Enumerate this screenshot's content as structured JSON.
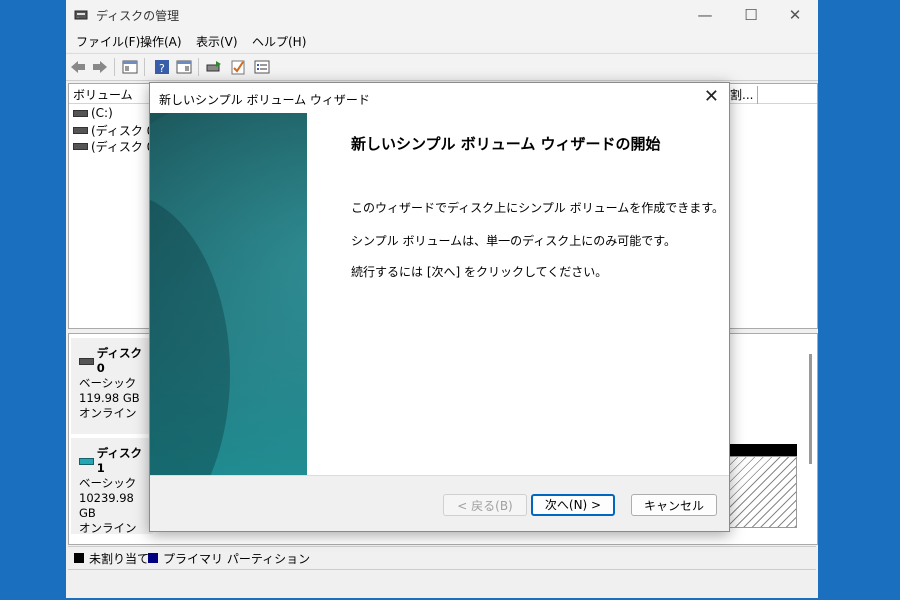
{
  "window": {
    "title": "ディスクの管理",
    "controls": {
      "minimize": "—",
      "maximize": "☐",
      "close": "✕"
    }
  },
  "menu": [
    "ファイル(F)",
    "操作(A)",
    "表示(V)",
    "ヘルプ(H)"
  ],
  "toolbar": {
    "icons": [
      "back-arrow-icon",
      "forward-arrow-icon",
      "console-tree-icon",
      "help-icon",
      "properties-icon",
      "rescan-icon",
      "check-icon",
      "list-icon"
    ]
  },
  "volume_list": {
    "column_header": "ボリューム",
    "column_header_2": "割...",
    "rows": [
      "(C:)",
      "(ディスク 0 パ",
      "(ディスク 0 パ"
    ]
  },
  "disks": [
    {
      "name": "ディスク 0",
      "type": "ベーシック",
      "size": "119.98 GB",
      "status": "オンライン"
    },
    {
      "name": "ディスク 1",
      "type": "ベーシック",
      "size": "10239.98 GB",
      "status": "オンライン"
    }
  ],
  "legend": {
    "unallocated": "未割り当て",
    "primary": "プライマリ パーティション",
    "colors": {
      "unallocated": "#000000",
      "primary": "#000080"
    }
  },
  "wizard": {
    "title": "新しいシンプル ボリューム ウィザード",
    "close": "✕",
    "heading": "新しいシンプル ボリューム ウィザードの開始",
    "paragraphs": [
      "このウィザードでディスク上にシンプル ボリュームを作成できます。",
      "シンプル ボリュームは、単一のディスク上にのみ可能です。",
      "続行するには [次へ] をクリックしてください。"
    ],
    "buttons": {
      "back": "< 戻る(B)",
      "next": "次へ(N) >",
      "cancel": "キャンセル"
    }
  }
}
